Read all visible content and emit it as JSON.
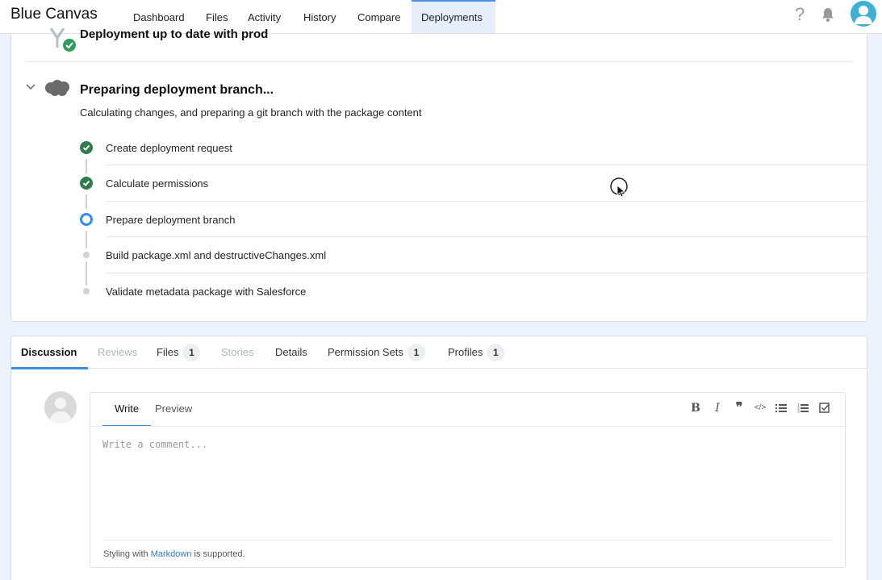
{
  "app": {
    "brand": "Blue Canvas"
  },
  "nav": {
    "tabs": [
      "Dashboard",
      "Files",
      "Activity",
      "History",
      "Compare",
      "Deployments"
    ],
    "active": "Deployments"
  },
  "status": {
    "uptodate_title": "Deployment up to date with prod",
    "prep_title": "Preparing deployment branch...",
    "prep_subtitle": "Calculating changes, and preparing a git branch with the package content",
    "steps": [
      {
        "label": "Create deployment request",
        "state": "done"
      },
      {
        "label": "Calculate permissions",
        "state": "done"
      },
      {
        "label": "Prepare deployment branch",
        "state": "active"
      },
      {
        "label": "Build package.xml and destructiveChanges.xml",
        "state": "pending"
      },
      {
        "label": "Validate metadata package with Salesforce",
        "state": "pending"
      }
    ]
  },
  "detail_tabs": {
    "discussion": "Discussion",
    "reviews": "Reviews",
    "files": "Files",
    "files_count": "1",
    "stories": "Stories",
    "details": "Details",
    "permission_sets": "Permission Sets",
    "permission_sets_count": "1",
    "profiles": "Profiles",
    "profiles_count": "1"
  },
  "editor": {
    "write": "Write",
    "preview": "Preview",
    "placeholder": "Write a comment...",
    "footer_prefix": "Styling with",
    "footer_link": "Markdown",
    "footer_suffix": "is supported.",
    "toolbar_icons": [
      "bold-icon",
      "italic-icon",
      "quote-icon",
      "code-icon",
      "bullet-list-icon",
      "numbered-list-icon",
      "task-list-icon"
    ]
  },
  "colors": {
    "accent": "#3a8fe0",
    "success": "#2e8b57",
    "active_step": "#2f8cf0",
    "avatar": "#3cb1d6"
  }
}
